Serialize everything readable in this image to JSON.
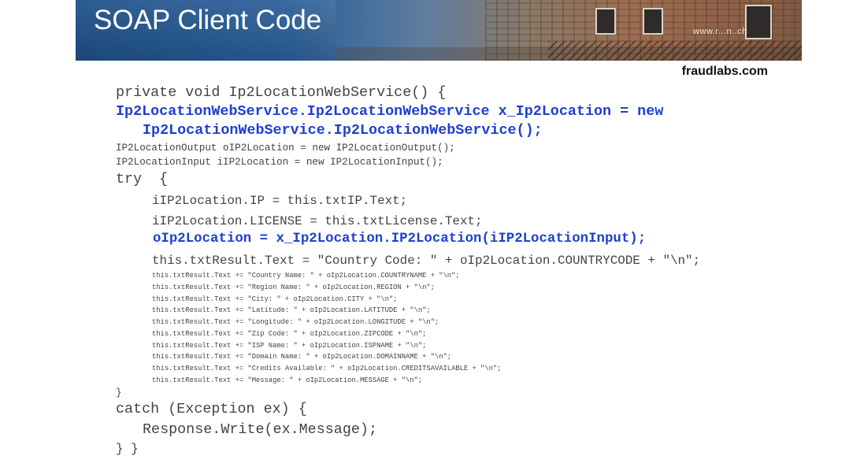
{
  "slide": {
    "title": "SOAP Client Code",
    "banner_watermark": "www.r...n..ch",
    "brand": "fraudlabs.com"
  },
  "code": [
    "private void Ip2LocationWebService() {",
    "Ip2LocationWebService.Ip2LocationWebService x_Ip2Location = new",
    "Ip2LocationWebService.Ip2LocationWebService();",
    "IP2LocationOutput oIP2Location = new IP2LocationOutput();",
    "IP2LocationInput iIP2Location = new IP2LocationInput();",
    "try  {",
    "iIP2Location.IP = this.txtIP.Text;",
    "iIP2Location.LICENSE = this.txtLicense.Text;",
    "oIp2Location = x_Ip2Location.IP2Location(iIP2LocationInput);",
    "this.txtResult.Text = \"Country Code: \" + oIp2Location.COUNTRYCODE + \"\\n\";",
    "this.txtResult.Text += \"Country Name: \" + oIp2Location.COUNTRYNAME + \"\\n\";",
    "this.txtResult.Text += \"Region Name: \" + oIp2Location.REGION + \"\\n\";",
    "this.txtResult.Text += \"City: \" + oIp2Location.CITY + \"\\n\";",
    "this.txtResult.Text += \"Latitude: \" + oIp2Location.LATITUDE + \"\\n\";",
    "this.txtResult.Text += \"Longitude: \" + oIp2Location.LONGITUDE + \"\\n\";",
    "this.txtResult.Text += \"Zip Code: \" + oIp2Location.ZIPCODE + \"\\n\";",
    "this.txtResult.Text += \"ISP Name: \" + oIp2Location.ISPNAME + \"\\n\";",
    "this.txtResult.Text += \"Domain Name: \" + oIp2Location.DOMAINNAME + \"\\n\";",
    "this.txtResult.Text += \"Credits Available: \" + oIp2Location.CREDITSAVAILABLE + \"\\n\";",
    "this.txtResult.Text += \"Message: \" + oIp2Location.MESSAGE + \"\\n\";",
    "}",
    "catch (Exception ex) {",
    "Response.Write(ex.Message);",
    "} }"
  ]
}
